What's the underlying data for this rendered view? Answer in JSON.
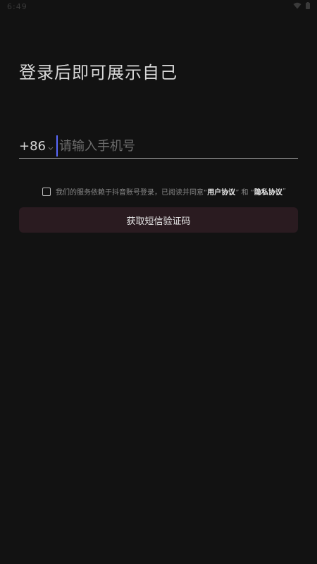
{
  "status_bar": {
    "time": "6:49",
    "wifi_icon": "wifi-icon",
    "battery_icon": "battery-icon"
  },
  "page": {
    "title": "登录后即可展示自己"
  },
  "phone": {
    "country_code": "+86",
    "chevron_icon": "chevron-down-icon",
    "placeholder": "请输入手机号",
    "value": ""
  },
  "agreement": {
    "checked": false,
    "text_before": "我们的服务依赖于抖音账号登录，已阅读并同意“",
    "user_agreement": "用户协议",
    "text_middle": "” 和 “",
    "privacy_agreement": "隐私协议",
    "text_after": "”"
  },
  "actions": {
    "get_sms_code_label": "获取短信验证码"
  },
  "colors": {
    "background": "#121212",
    "button_bg": "#2a1b20",
    "cursor_accent": "#5a6aff",
    "divider": "#9a9a9a"
  }
}
